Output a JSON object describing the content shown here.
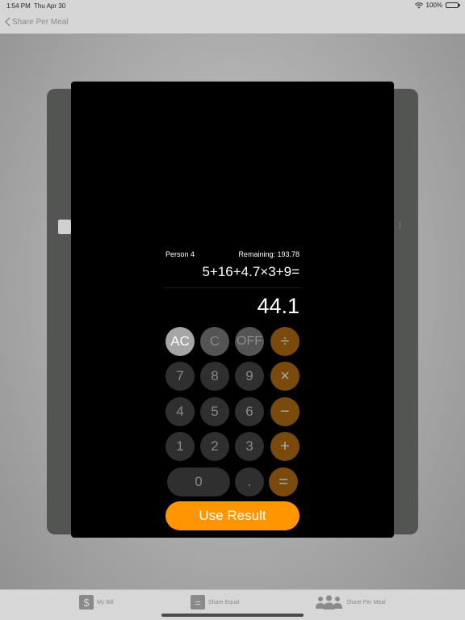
{
  "status_bar": {
    "time": "1:54 PM",
    "date": "Thu Apr 30",
    "battery": "100%",
    "battery_level": 1.0
  },
  "nav": {
    "back_label": "Share Per Meal"
  },
  "calculator": {
    "person": "Person 4",
    "remaining": "Remaining: 193.78",
    "expression": "5+16+4.7×3+9=",
    "result": "44.1",
    "keys": {
      "ac": "AC",
      "c": "C",
      "off": "OFF",
      "divide": "÷",
      "seven": "7",
      "eight": "8",
      "nine": "9",
      "multiply": "×",
      "four": "4",
      "five": "5",
      "six": "6",
      "minus": "−",
      "one": "1",
      "two": "2",
      "three": "3",
      "plus": "+",
      "zero": "0",
      "dot": ".",
      "equals": "="
    },
    "use_result_label": "Use Result",
    "accent_color": "#ff9500"
  },
  "tabs": [
    {
      "label": "My Bill",
      "icon": "dollar-icon",
      "glyph": "$"
    },
    {
      "label": "Share Equal",
      "icon": "equals-icon",
      "glyph": "="
    },
    {
      "label": "Share Per Meal",
      "icon": "people-icon"
    }
  ]
}
